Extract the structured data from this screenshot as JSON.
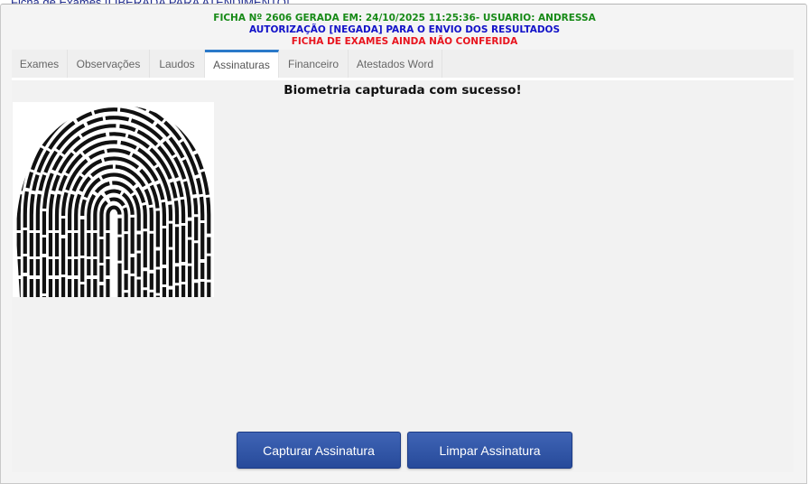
{
  "window": {
    "title": "Ficha de Exames [LIBERADA PARA ATENDIMENTO]"
  },
  "header": {
    "line1": "FICHA Nº 2606 GERADA EM: 24/10/2025 11:25:36- USUARIO: ANDRESSA",
    "line2": "AUTORIZAÇÃO [NEGADA] PARA O ENVIO DOS RESULTADOS",
    "line3": "FICHA DE EXAMES AINDA NÃO CONFERIDA"
  },
  "tabs": [
    {
      "label": "Exames",
      "active": false
    },
    {
      "label": "Observações",
      "active": false
    },
    {
      "label": "Laudos",
      "active": false
    },
    {
      "label": "Assinaturas",
      "active": true
    },
    {
      "label": "Financeiro",
      "active": false
    },
    {
      "label": "Atestados Word",
      "active": false
    }
  ],
  "content": {
    "biometry_message": "Biometria capturada com sucesso!",
    "fingerprint_icon": "fingerprint-image"
  },
  "buttons": {
    "capture_label": "Capturar Assinatura",
    "clear_label": "Limpar Assinatura"
  },
  "colors": {
    "accent": "#2a79c9",
    "button": "#3354a8",
    "green": "#178a17",
    "blue": "#1212c8",
    "red": "#e8141e"
  }
}
